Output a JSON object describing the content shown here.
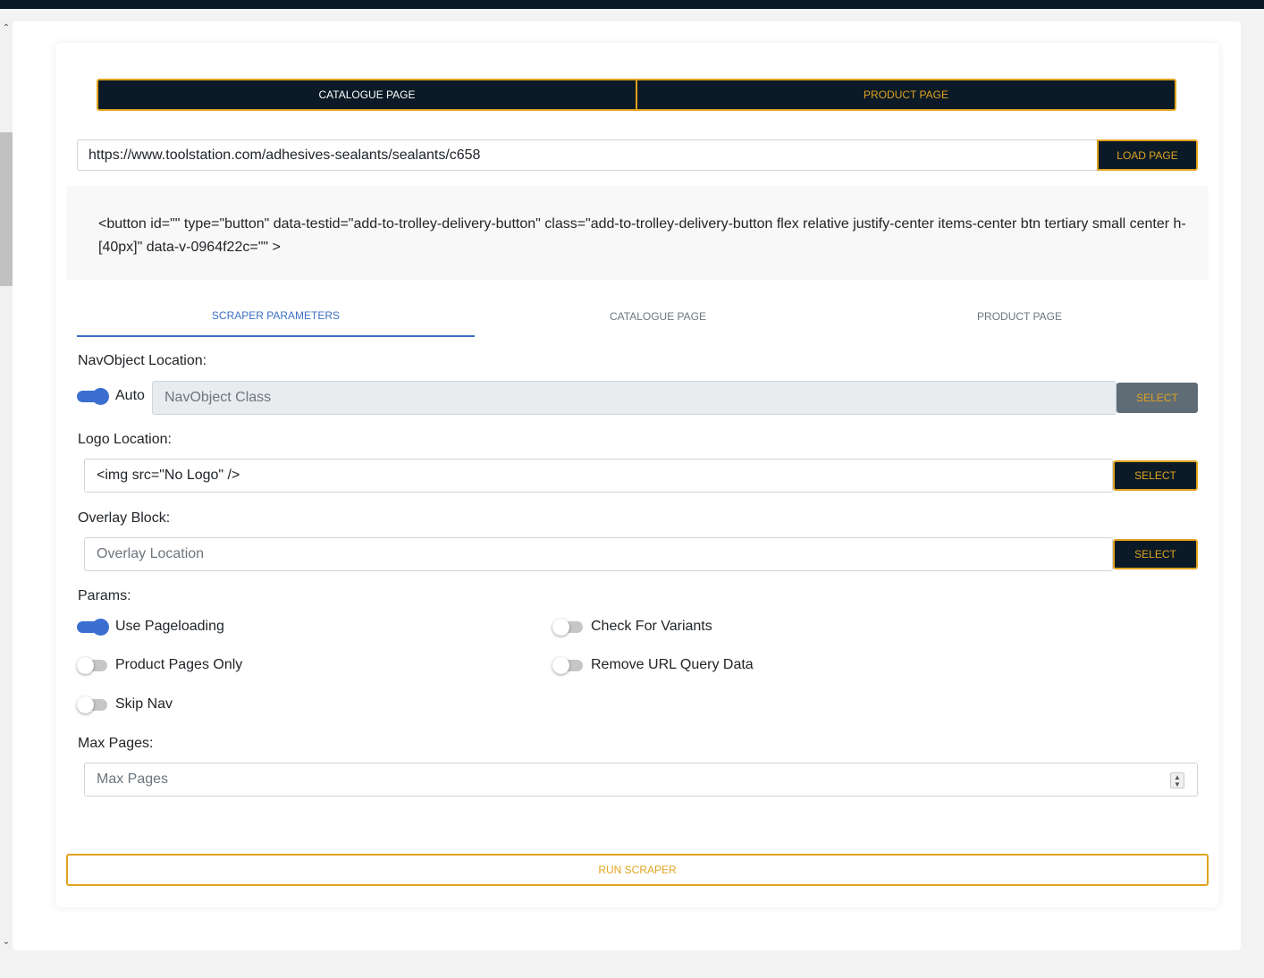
{
  "mode_toggle": {
    "catalogue_label": "CATALOGUE PAGE",
    "product_label": "PRODUCT PAGE"
  },
  "url_bar": {
    "value": "https://www.toolstation.com/adhesives-sealants/sealants/c658",
    "load_label": "LOAD PAGE"
  },
  "selected_element_html": "<button id=\"\" type=\"button\" data-testid=\"add-to-trolley-delivery-button\" class=\"add-to-trolley-delivery-button flex relative justify-center items-center btn tertiary small center h-[40px]\" data-v-0964f22c=\"\" >",
  "tabs": [
    {
      "label": "SCRAPER PARAMETERS",
      "active": true
    },
    {
      "label": "CATALOGUE PAGE",
      "active": false
    },
    {
      "label": "PRODUCT PAGE",
      "active": false
    }
  ],
  "nav_object": {
    "label": "NavObject Location:",
    "auto_label": "Auto",
    "auto_on": true,
    "placeholder": "NavObject Class",
    "select_label": "SELECT"
  },
  "logo": {
    "label": "Logo Location:",
    "value": "<img src=\"No Logo\" />",
    "select_label": "SELECT"
  },
  "overlay": {
    "label": "Overlay Block:",
    "placeholder": "Overlay Location",
    "select_label": "SELECT"
  },
  "params": {
    "label": "Params:",
    "use_pageloading": {
      "label": "Use Pageloading",
      "on": true
    },
    "check_for_variants": {
      "label": "Check For Variants",
      "on": false
    },
    "product_pages_only": {
      "label": "Product Pages Only",
      "on": false
    },
    "remove_url_query_data": {
      "label": "Remove URL Query Data",
      "on": false
    },
    "skip_nav": {
      "label": "Skip Nav",
      "on": false
    }
  },
  "max_pages": {
    "label": "Max Pages:",
    "placeholder": "Max Pages"
  },
  "run_label": "RUN SCRAPER",
  "colors": {
    "navy": "#0b1a26",
    "gold": "#e0a31f",
    "accent_blue": "#3a6fd1"
  }
}
